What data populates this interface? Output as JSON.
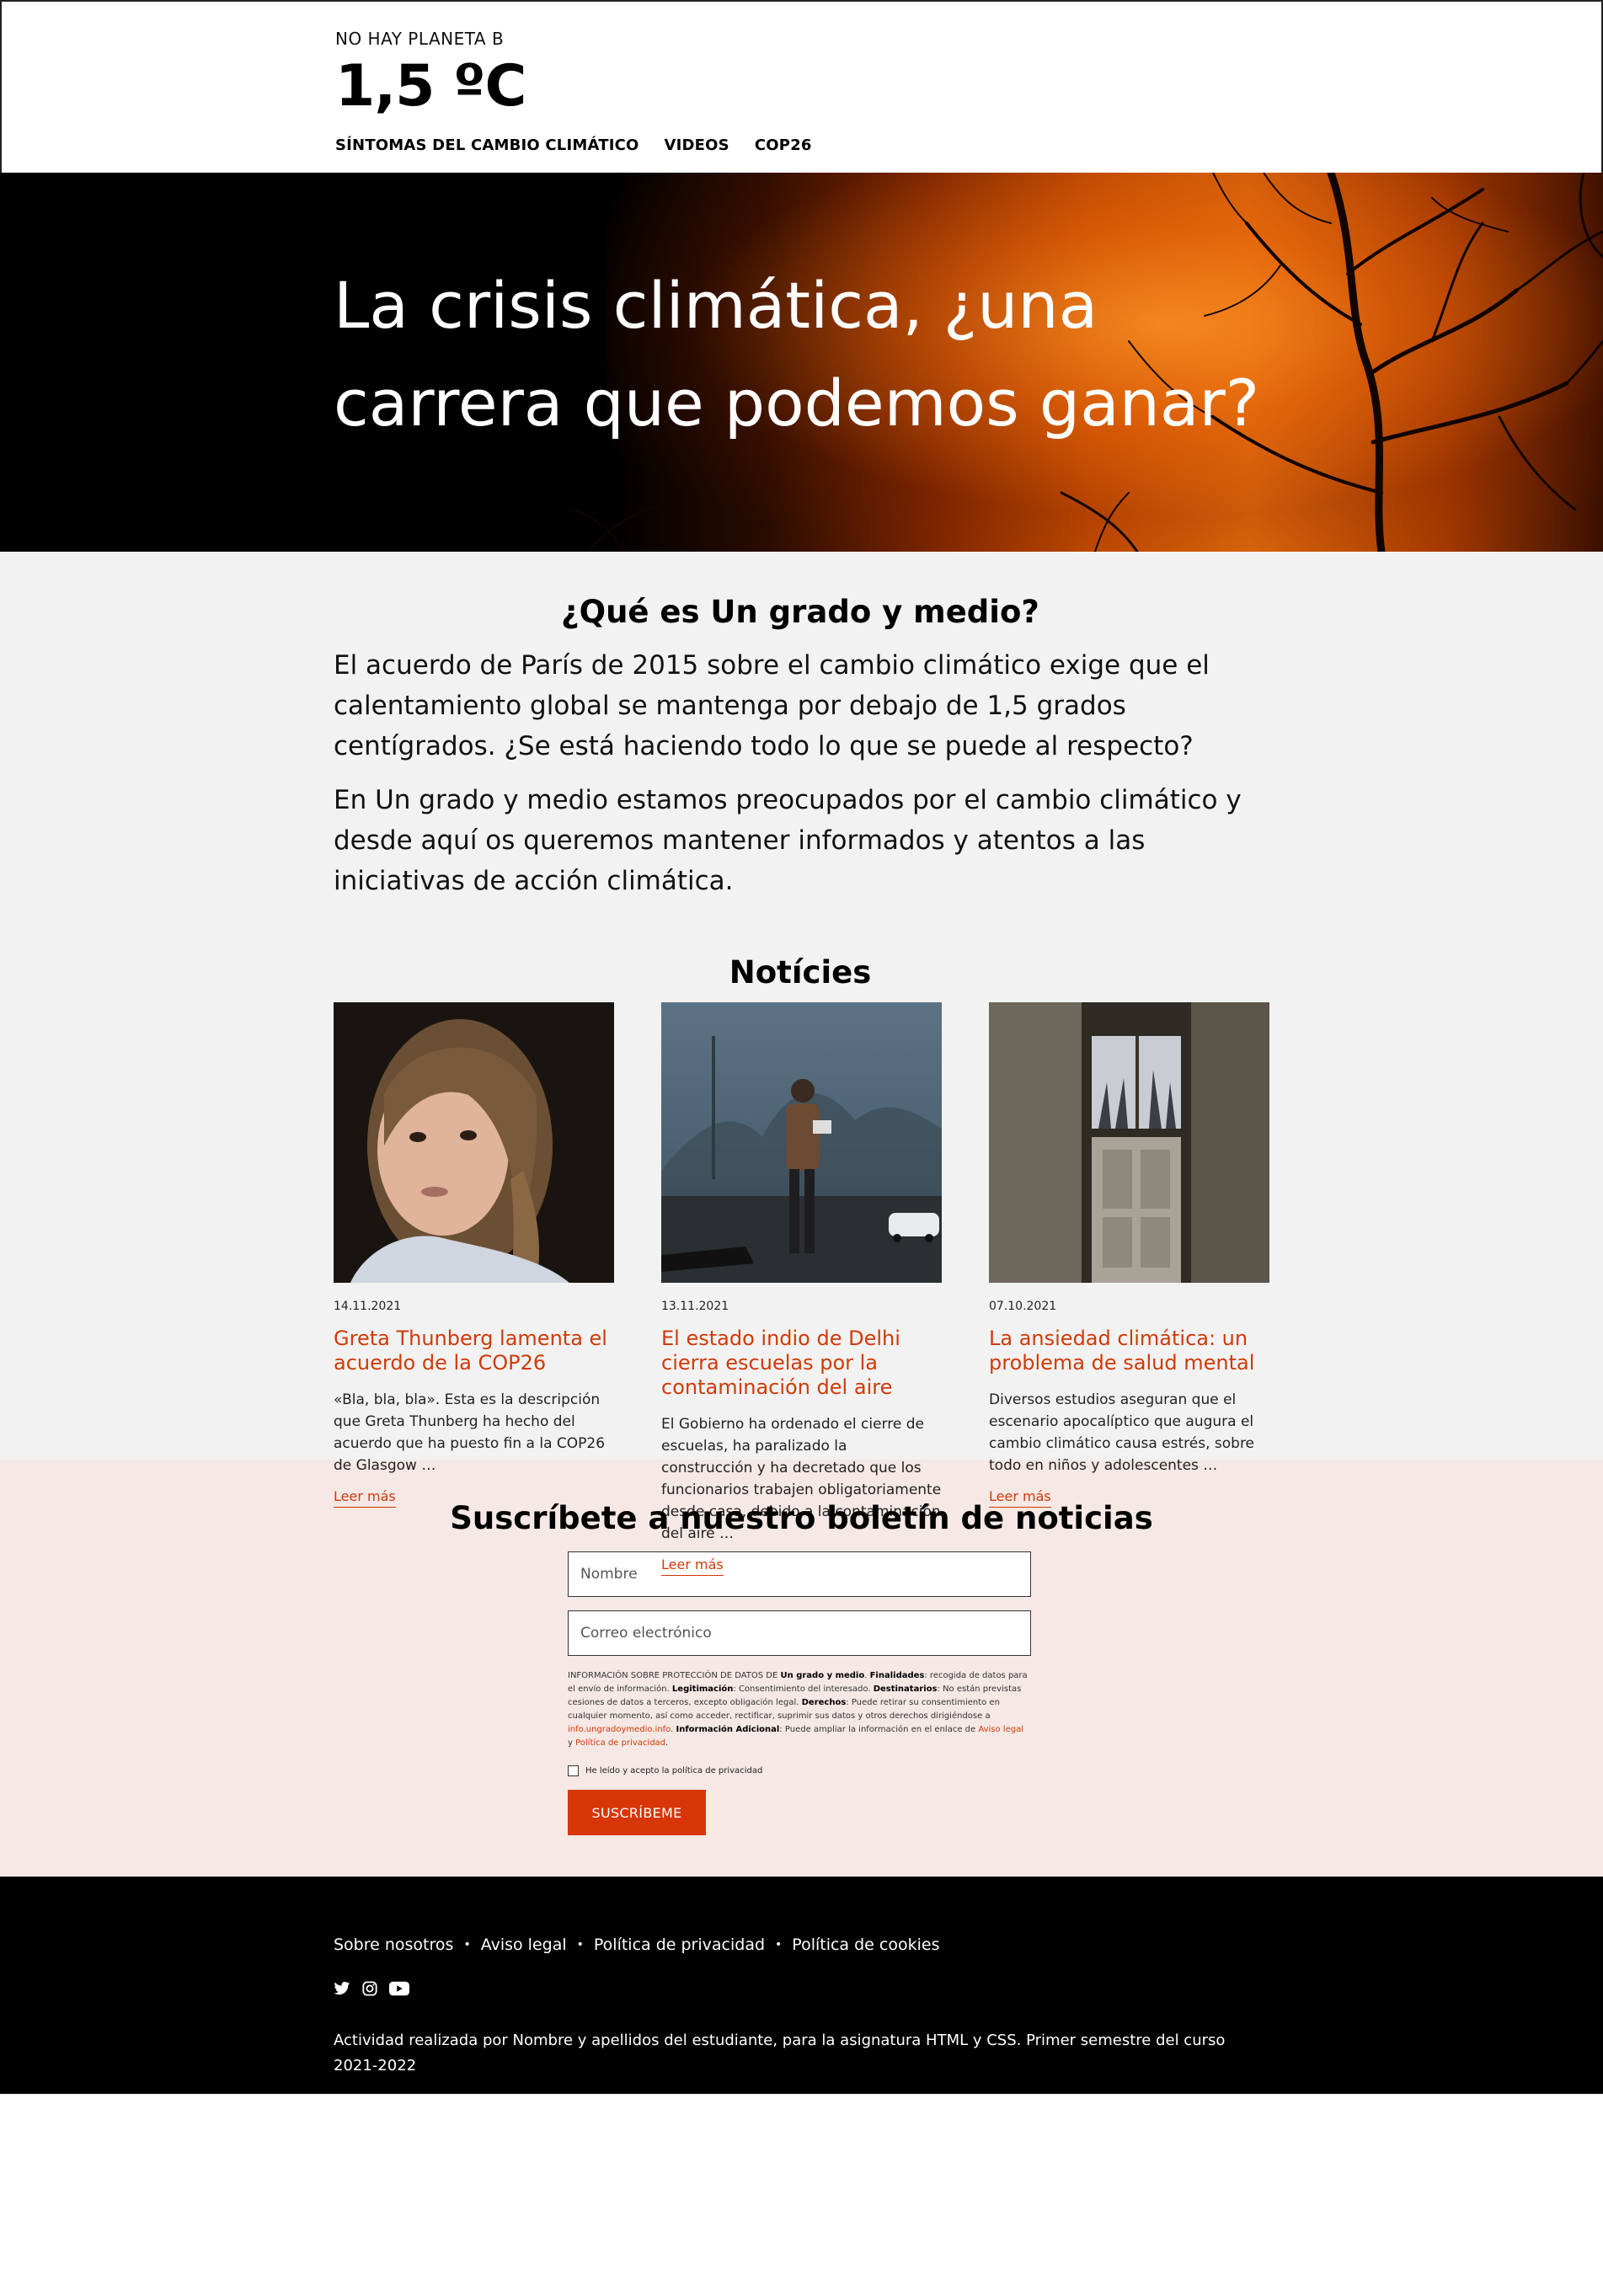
{
  "site": {
    "tagline": "NO HAY PLANETA B",
    "logo": "1,5 ºC"
  },
  "nav": {
    "items": [
      {
        "label": "SÍNTOMAS DEL CAMBIO CLIMÁTICO"
      },
      {
        "label": "VIDEOS"
      },
      {
        "label": "COP26"
      }
    ]
  },
  "hero": {
    "title_line1": "La crisis climática, ¿una",
    "title_line2": "carrera que podemos ganar?"
  },
  "about": {
    "heading": "¿Qué es Un grado y medio?",
    "p1": "El acuerdo de París de 2015 sobre el cambio climático exige que el calentamiento global se mantenga por debajo de 1,5 grados centígrados. ¿Se está haciendo todo lo que se puede al respecto?",
    "p2": "En Un grado y medio estamos preocupados por el cambio climático y desde aquí os queremos mantener informados y atentos a las iniciativas de acción climática."
  },
  "news": {
    "heading": "Notícies",
    "items": [
      {
        "date": "14.11.2021",
        "title": "Greta Thunberg lamenta el acuerdo de la COP26",
        "excerpt": "«Bla, bla, bla». Esta es la descripción que Greta Thunberg ha hecho del acuerdo que ha puesto fin a la COP26 de Glasgow …",
        "more": "Leer más"
      },
      {
        "date": "13.11.2021",
        "title": "El estado indio de Delhi cierra escuelas por la contaminación del aire",
        "excerpt": "El Gobierno ha ordenado el cierre de escuelas, ha paralizado la construcción y ha decretado que los funcionarios trabajen obligatoriamente desde casa, debido a la contaminación del aire …",
        "more": "Leer más"
      },
      {
        "date": "07.10.2021",
        "title": "La ansiedad climática: un problema de salud mental",
        "excerpt": "Diversos estudios aseguran que el escenario apocalíptico que augura el cambio climático causa estrés, sobre todo en niños y adolescentes …",
        "more": "Leer más"
      }
    ]
  },
  "newsletter": {
    "heading": "Suscríbete a nuestro boletín de noticias",
    "name_placeholder": "Nombre",
    "email_placeholder": "Correo electrónico",
    "legal": {
      "t1": "INFORMACIÓN SOBRE PROTECCIÓN DE DATOS DE ",
      "b1": "Un grado y medio",
      "t2": ". ",
      "b2": "Finalidades",
      "t3": ": recogida de datos para el envío de información. ",
      "b3": "Legitimación",
      "t4": ": Consentimiento del interesado. ",
      "b4": "Destinatarios",
      "t5": ": No están previstas cesiones de datos a terceros, excepto obligación legal. ",
      "b5": "Derechos",
      "t6": ": Puede retirar su consentimiento en cualquier momento, así como acceder, rectificar, suprimir sus datos y otros derechos dirigiéndose a ",
      "l1": "info.ungradoymedio.info",
      "t7": ". ",
      "b6": "Información Adicional",
      "t8": ": Puede ampliar la información en el enlace de ",
      "l2": "Aviso legal",
      "t9": " y ",
      "l3": "Política de privacidad",
      "t10": "."
    },
    "checkbox_label": "He leído y acepto la política de privacidad",
    "submit_label": "SUSCRÍBEME"
  },
  "footer": {
    "links": [
      {
        "label": "Sobre nosotros"
      },
      {
        "label": "Aviso legal"
      },
      {
        "label": "Política de privacidad"
      },
      {
        "label": "Política de cookies"
      }
    ],
    "social": [
      "twitter-icon",
      "instagram-icon",
      "youtube-icon"
    ],
    "credits": "Actividad realizada por Nombre y apellidos del estudiante, para la asignatura HTML y CSS. Primer semestre del curso 2021-2022",
    "to_top": "^"
  },
  "colors": {
    "accent": "#d13a08",
    "button": "#d83508",
    "grey_bg": "#f2f2f2",
    "newsletter_bg": "#f5e8e5",
    "footer_bg": "#000000"
  }
}
